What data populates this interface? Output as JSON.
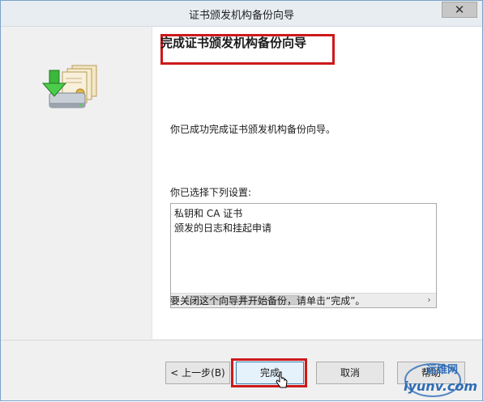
{
  "window": {
    "title": "证书颁发机构备份向导",
    "close_label": "✕"
  },
  "content": {
    "heading": "完成证书颁发机构备份向导",
    "success_text": "你已成功完成证书颁发机构备份向导。",
    "settings_label": "你已选择下列设置:",
    "settings_items": [
      "私钥和 CA 证书",
      "颁发的日志和挂起申请"
    ],
    "scroll_grip": "III",
    "close_instruction": "要关闭这个向导并开始备份，请单击“完成”。"
  },
  "buttons": {
    "back": "< 上一步(B)",
    "finish": "完成",
    "cancel": "取消",
    "help": "帮助"
  },
  "watermark": {
    "top": "运维网",
    "bottom": "iyunv.com"
  },
  "colors": {
    "highlight_border": "#cc1a1a",
    "accent": "#3c7fb1"
  }
}
